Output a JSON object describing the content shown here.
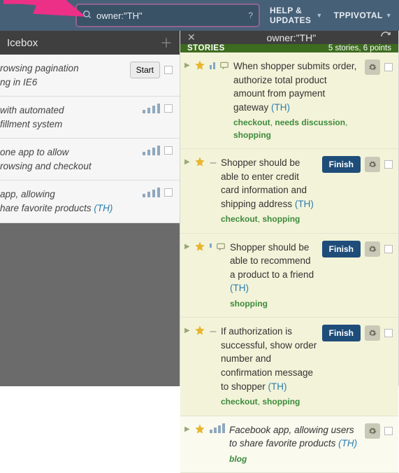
{
  "topbar": {
    "search_value": "owner:\"TH\"",
    "help_label": "HELP & UPDATES",
    "app_label": "TPPIVOTAL"
  },
  "icebox": {
    "title": "Icebox",
    "cards": [
      {
        "text_prefix": "rowsing pagination ",
        "text_suffix": "ng in IE6",
        "start_label": "Start",
        "has_start": true,
        "has_estimate": false
      },
      {
        "text_prefix": "with automated ",
        "text_suffix": "fillment system",
        "has_start": false,
        "has_estimate": true
      },
      {
        "text_prefix": "one app to allow ",
        "text_suffix": "rowsing and checkout",
        "has_start": false,
        "has_estimate": true
      },
      {
        "text_prefix": "app, allowing ",
        "text_suffix": "hare favorite products ",
        "owner": "(TH)",
        "has_start": false,
        "has_estimate": true
      }
    ]
  },
  "search_panel": {
    "title": "owner:\"TH\"",
    "stories_label": "STORIES",
    "count_text": "5 stories, 6 points",
    "stories": [
      {
        "state": "started",
        "has_comments": true,
        "points": 2,
        "text": "When shopper submits order, authorize total product amount from payment gateway ",
        "owner": "(TH)",
        "labels": [
          "checkout",
          "needs discussion",
          "shopping"
        ],
        "action": null,
        "italic": false
      },
      {
        "state": "started",
        "has_comments": false,
        "points": 0,
        "text": "Shopper should be able to enter credit card information and shipping address ",
        "owner": "(TH)",
        "labels": [
          "checkout",
          "shopping"
        ],
        "action": "Finish",
        "italic": false
      },
      {
        "state": "started",
        "has_comments": true,
        "points": 1,
        "text": "Shopper should be able to recommend a product to a friend ",
        "owner": "(TH)",
        "labels": [
          "shopping"
        ],
        "action": "Finish",
        "italic": false
      },
      {
        "state": "started",
        "has_comments": false,
        "points": 0,
        "text": "If authorization is successful, show order number and confirmation message to shopper ",
        "owner": "(TH)",
        "labels": [
          "checkout",
          "shopping"
        ],
        "action": "Finish",
        "italic": false
      },
      {
        "state": "unstarted",
        "has_comments": false,
        "points": 0,
        "text": "Facebook app, allowing users to share favorite products ",
        "owner": "(TH)",
        "labels": [
          "blog"
        ],
        "action": null,
        "italic": true,
        "has_estimate": true
      }
    ]
  }
}
